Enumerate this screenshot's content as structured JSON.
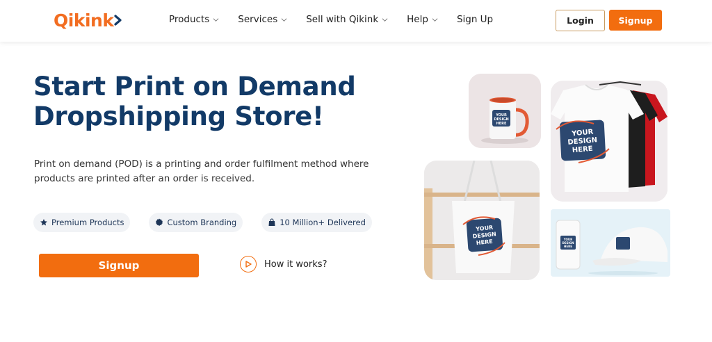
{
  "brand": {
    "name": "Qikink",
    "accent": "#f26d0f",
    "title_color": "#123a67"
  },
  "nav": {
    "items": [
      {
        "label": "Products",
        "has_dropdown": true
      },
      {
        "label": "Services",
        "has_dropdown": true
      },
      {
        "label": "Sell with Qikink",
        "has_dropdown": true
      },
      {
        "label": "Help",
        "has_dropdown": true
      },
      {
        "label": "Sign Up",
        "has_dropdown": false
      }
    ],
    "login_label": "Login",
    "signup_label": "Signup"
  },
  "hero": {
    "title_line1": "Start Print on Demand",
    "title_line2": "Dropshipping Store!",
    "description": "Print on demand (POD) is a printing and order fulfilment method where products are printed after an order is received.",
    "chips": [
      {
        "label": "Premium Products",
        "icon": "star-icon"
      },
      {
        "label": "Custom Branding",
        "icon": "badge-icon"
      },
      {
        "label": "10 Million+ Delivered",
        "icon": "bag-icon"
      }
    ],
    "signup_label": "Signup",
    "how_label": "How it works?"
  },
  "mockups": {
    "design_text_lines": [
      "YOUR",
      "DESIGN",
      "HERE"
    ]
  }
}
